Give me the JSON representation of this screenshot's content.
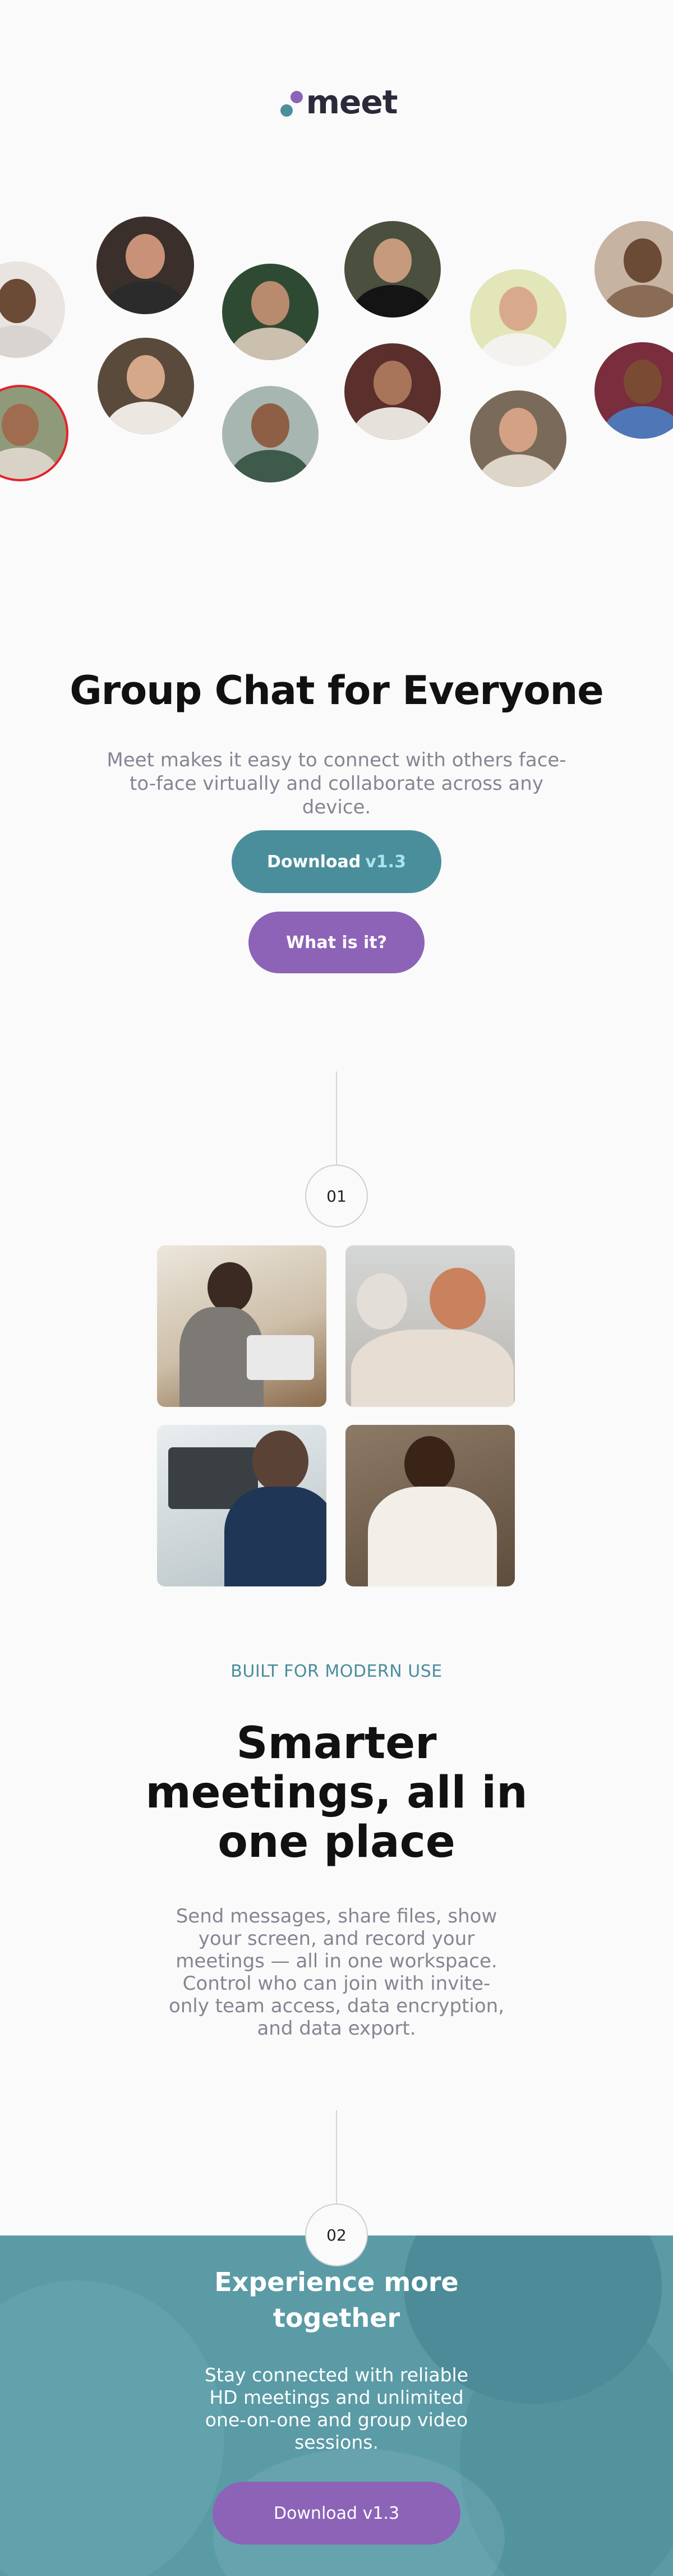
{
  "brand": {
    "name": "meet",
    "dot_colors": [
      "#8b63b8",
      "#4b8f9b"
    ]
  },
  "hero": {
    "title": "Group Chat for Everyone",
    "subtitle": "Meet makes it easy to connect with others face-to-face virtually and collaborate across any device.",
    "download_label": "Download",
    "download_version": "v1.3",
    "what_label": "What is it?"
  },
  "steps": [
    "01",
    "02"
  ],
  "features": {
    "eyebrow": "BUILT FOR MODERN USE",
    "title": "Smarter meetings, all in one place",
    "description": "Send messages, share files, show your screen, and record your meetings — all in one workspace. Control who can join with invite-only team access, data encryption, and data export."
  },
  "experience": {
    "title": "Experience more together",
    "description": "Stay connected with reliable HD meetings and unlimited one-on-one and group video sessions.",
    "download_label": "Download v1.3"
  },
  "colors": {
    "teal": "#4a8e9b",
    "purple": "#8d63b8",
    "muted_text": "#858593",
    "background": "#fafafa"
  }
}
